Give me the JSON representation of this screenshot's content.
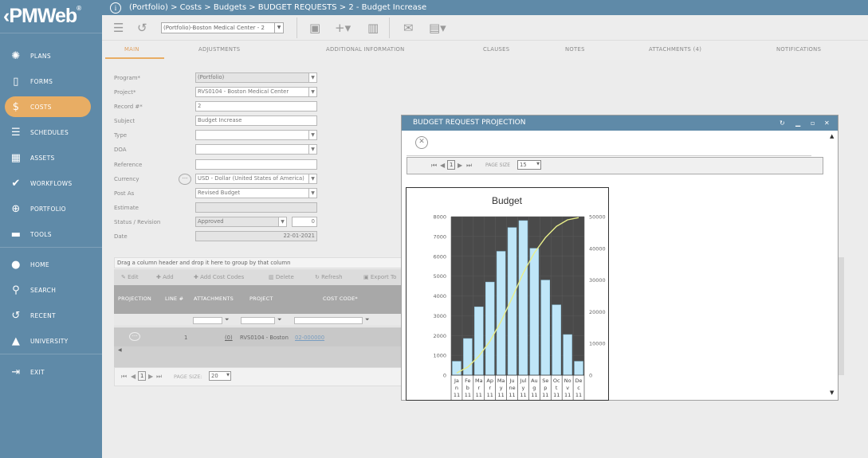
{
  "app": {
    "logo_text": "PMWeb",
    "logo_reg": "®",
    "back_chevron": "‹"
  },
  "breadcrumb": "(Portfolio) > Costs > Budgets > BUDGET REQUESTS > 2 - Budget Increase",
  "sidebar": {
    "items": [
      {
        "label": "PLANS",
        "icon": "lightbulb-icon"
      },
      {
        "label": "FORMS",
        "icon": "document-icon"
      },
      {
        "label": "COSTS",
        "icon": "dollar-icon"
      },
      {
        "label": "SCHEDULES",
        "icon": "schedule-icon"
      },
      {
        "label": "ASSETS",
        "icon": "building-icon"
      },
      {
        "label": "WORKFLOWS",
        "icon": "check-icon"
      },
      {
        "label": "PORTFOLIO",
        "icon": "globe-icon"
      },
      {
        "label": "TOOLS",
        "icon": "toolbox-icon"
      }
    ],
    "bottom_items": [
      {
        "label": "HOME",
        "icon": "home-icon"
      },
      {
        "label": "SEARCH",
        "icon": "search-icon"
      },
      {
        "label": "RECENT",
        "icon": "history-icon"
      },
      {
        "label": "UNIVERSITY",
        "icon": "graduation-cap-icon"
      },
      {
        "label": "EXIT",
        "icon": "exit-icon"
      }
    ]
  },
  "toolbar": {
    "project_select": "(Portfolio)-Boston Medical Center - 2"
  },
  "tabs": [
    {
      "label": "MAIN"
    },
    {
      "label": "ADJUSTMENTS"
    },
    {
      "label": "ADDITIONAL INFORMATION"
    },
    {
      "label": "CLAUSES"
    },
    {
      "label": "NOTES"
    },
    {
      "label": "ATTACHMENTS (4)"
    },
    {
      "label": "NOTIFICATIONS"
    }
  ],
  "form": {
    "program": {
      "label": "Program*",
      "value": "(Portfolio)"
    },
    "project": {
      "label": "Project*",
      "value": "RVS0104 - Boston Medical Center"
    },
    "record": {
      "label": "Record #*",
      "value": "2"
    },
    "subject": {
      "label": "Subject",
      "value": "Budget Increase"
    },
    "type": {
      "label": "Type",
      "value": ""
    },
    "doa": {
      "label": "DOA",
      "value": ""
    },
    "reference": {
      "label": "Reference",
      "value": ""
    },
    "currency": {
      "label": "Currency",
      "value": "USD - Dollar (United States of America)"
    },
    "post_as": {
      "label": "Post As",
      "value": "Revised Budget"
    },
    "estimate": {
      "label": "Estimate",
      "value": ""
    },
    "status": {
      "label": "Status / Revision",
      "value": "Approved",
      "revision": "0"
    },
    "date": {
      "label": "Date",
      "value": "22-01-2021"
    }
  },
  "grid": {
    "drag_hint": "Drag a column header and drop it here to group by that column",
    "buttons": {
      "edit": "Edit",
      "add": "Add",
      "add_cost_codes": "Add Cost Codes",
      "delete": "Delete",
      "refresh": "Refresh",
      "export": "Export To"
    },
    "columns": [
      "PROJECTION",
      "LINE #",
      "ATTACHMENTS",
      "PROJECT",
      "COST CODE*"
    ],
    "row": {
      "line": "1",
      "attachments": "(0)",
      "project": "RVS0104 - Boston",
      "cost_code": "02-000000"
    },
    "pager": {
      "page": "1",
      "page_size_label": "PAGE SIZE:",
      "page_size": "20"
    }
  },
  "dialog": {
    "title": "BUDGET REQUEST PROJECTION",
    "pager": {
      "page": "1",
      "page_size_label": "PAGE SIZE",
      "page_size": "15"
    }
  },
  "chart_data": {
    "type": "bar",
    "title": "Budget",
    "categories": [
      "Jan 11",
      "Feb 11",
      "Mar 11",
      "Apr 11",
      "May 11",
      "June 11",
      "July 11",
      "Aug 11",
      "Sept 11",
      "Oct 11",
      "Nov 11",
      "Dec 11"
    ],
    "category_lines": [
      [
        "Ja",
        "n",
        "11"
      ],
      [
        "Fe",
        "b",
        "11"
      ],
      [
        "Ma",
        "r",
        "11"
      ],
      [
        "Ap",
        "r",
        "11"
      ],
      [
        "Ma",
        "y",
        "11"
      ],
      [
        "Ju",
        "ne",
        "11"
      ],
      [
        "Jul",
        "y",
        "11"
      ],
      [
        "Au",
        "g",
        "11"
      ],
      [
        "Se",
        "p",
        "11"
      ],
      [
        "Oc",
        "t",
        "11"
      ],
      [
        "No",
        "v",
        "11"
      ],
      [
        "De",
        "c",
        "11"
      ]
    ],
    "series": [
      {
        "type": "bar",
        "axis": "left",
        "values": [
          700,
          1850,
          3450,
          4700,
          6250,
          7450,
          7800,
          6400,
          4800,
          3550,
          2050,
          700
        ]
      },
      {
        "type": "line",
        "axis": "right",
        "values": [
          700,
          2550,
          6000,
          10700,
          16950,
          24400,
          32200,
          38600,
          43400,
          46950,
          49000,
          49700
        ]
      }
    ],
    "ylim": [
      0,
      8000
    ],
    "yticks": [
      0,
      1000,
      2000,
      3000,
      4000,
      5000,
      6000,
      7000,
      8000
    ],
    "y2lim": [
      0,
      50000
    ],
    "y2ticks": [
      0,
      10000,
      20000,
      30000,
      40000,
      50000
    ],
    "grid": true,
    "colors": {
      "bar": "#bfe6f8",
      "line": "#e8ee8a",
      "plot_bg": "#4a4a4a"
    }
  }
}
